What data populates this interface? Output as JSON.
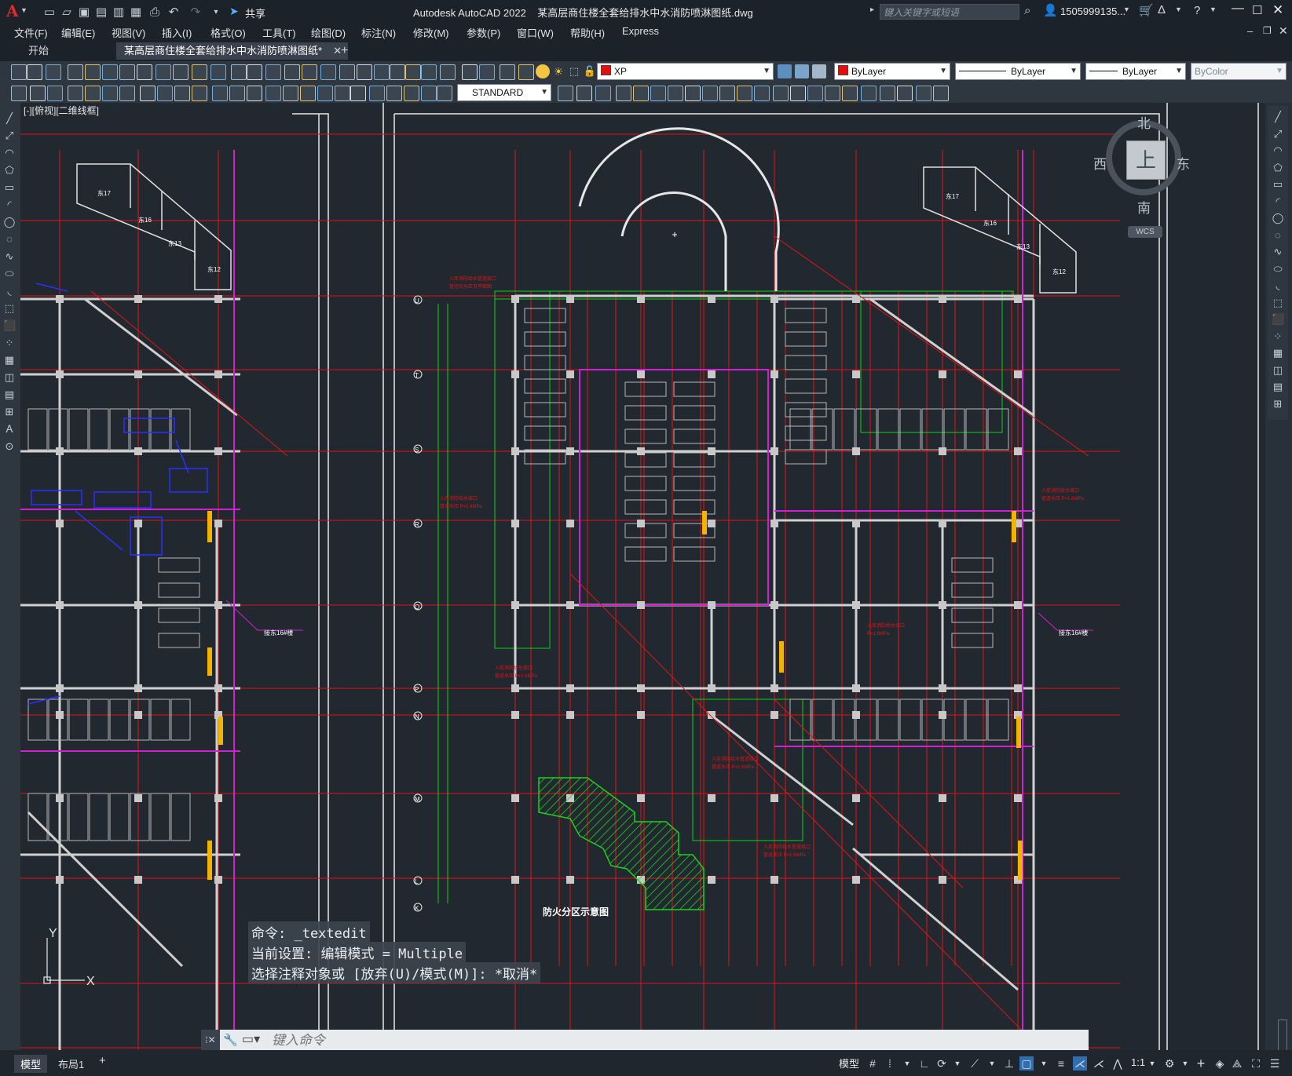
{
  "window": {
    "app_title": "Autodesk AutoCAD 2022",
    "file_title": "某高层商住楼全套给排水中水消防喷淋图纸.dwg",
    "search_placeholder": "键入关键字或短语",
    "user_label": "1505999135...",
    "share_label": "共享"
  },
  "menu": [
    "文件(F)",
    "编辑(E)",
    "视图(V)",
    "插入(I)",
    "格式(O)",
    "工具(T)",
    "绘图(D)",
    "标注(N)",
    "修改(M)",
    "参数(P)",
    "窗口(W)",
    "帮助(H)",
    "Express"
  ],
  "tabs": {
    "start": "开始",
    "active": "某高层商住楼全套给排水中水消防喷淋图纸*"
  },
  "properties": {
    "layer": "XP",
    "color": "ByLayer",
    "linetype": "ByLayer",
    "lineweight": "ByLayer",
    "plotstyle": "ByColor",
    "text_style": "STANDARD",
    "layer_color": "#e01010"
  },
  "viewport_label": "[-][俯视][二维线框]",
  "viewcube": {
    "north": "北",
    "south": "南",
    "east": "东",
    "west": "西",
    "top": "上",
    "wcs": "WCS"
  },
  "drawing": {
    "room_labels_left": [
      "东17",
      "东16",
      "东13",
      "东12"
    ],
    "room_labels_right": [
      "东17",
      "东16",
      "东13",
      "东12"
    ],
    "grid_labels": [
      "U",
      "T",
      "S",
      "R",
      "Q",
      "P",
      "N",
      "M",
      "L",
      "K"
    ],
    "section_title": "防火分区示意图",
    "ref_note_left": "接东16#楼",
    "ref_note_right": "接东16#楼"
  },
  "command": {
    "history": [
      "命令: _textedit",
      "当前设置: 编辑模式 = Multiple",
      "选择注释对象或 [放弃(U)/模式(M)]: *取消*"
    ],
    "input_placeholder": "键入命令"
  },
  "status": {
    "model_tab": "模型",
    "layout_tab": "布局1",
    "model_label": "模型",
    "scale": "1:1"
  },
  "axis": {
    "y": "Y",
    "x": "X"
  }
}
